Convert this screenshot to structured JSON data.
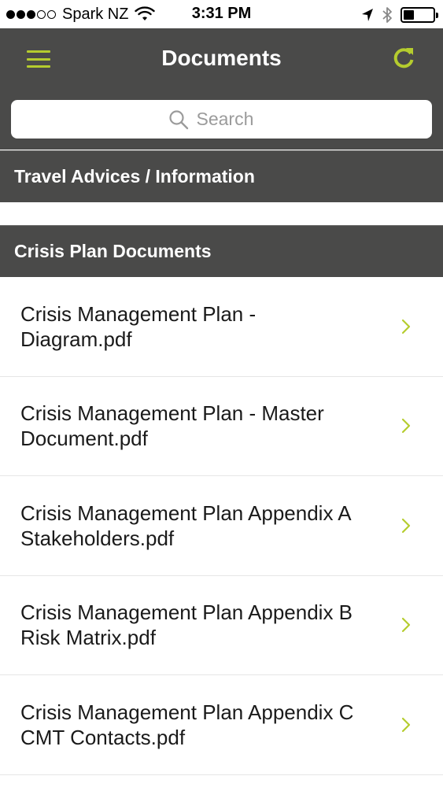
{
  "status_bar": {
    "carrier": "Spark NZ",
    "time": "3:31 PM",
    "signal_strength_dots": 3,
    "signal_total_dots": 5,
    "battery_level": 0.35
  },
  "header": {
    "title": "Documents",
    "menu_icon": "hamburger-menu-icon",
    "refresh_icon": "refresh-icon"
  },
  "search": {
    "placeholder": "Search",
    "value": ""
  },
  "sections": [
    {
      "title": "Travel Advices / Information",
      "items": []
    },
    {
      "title": "Crisis Plan Documents",
      "items": [
        {
          "line1": "Crisis Management Plan -",
          "line2": "Diagram.pdf"
        },
        {
          "line1": "Crisis Management Plan - Master",
          "line2": "Document.pdf"
        },
        {
          "line1": "Crisis Management Plan Appendix A",
          "line2": "Stakeholders.pdf"
        },
        {
          "line1": "Crisis Management Plan Appendix B",
          "line2": "Risk Matrix.pdf"
        },
        {
          "line1": "Crisis Management Plan Appendix C",
          "line2": "CMT Contacts.pdf"
        }
      ]
    }
  ],
  "colors": {
    "header_bg": "#4a4a49",
    "accent": "#b5cc2e",
    "text": "#1a1a1a"
  }
}
